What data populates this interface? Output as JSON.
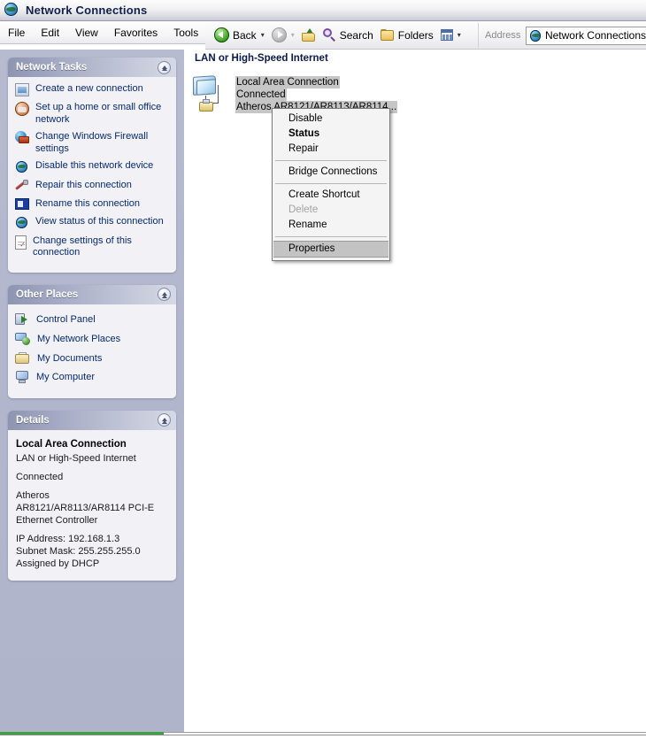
{
  "window": {
    "title": "Network Connections",
    "title_icon": "network-globe-icon"
  },
  "menubar": {
    "items": [
      "File",
      "Edit",
      "View",
      "Favorites",
      "Tools"
    ],
    "overflow": "»"
  },
  "toolbar": {
    "back_label": "Back",
    "back_icon": "back-arrow-icon",
    "forward_icon": "forward-arrow-icon",
    "up_icon": "up-folder-icon",
    "search_label": "Search",
    "search_icon": "magnifier-icon",
    "folders_label": "Folders",
    "folders_icon": "folder-icon",
    "views_icon": "views-icon",
    "caret": "▾"
  },
  "address": {
    "label": "Address",
    "value": "Network Connections",
    "icon": "network-globe-icon"
  },
  "sidebar": {
    "network_tasks": {
      "title": "Network Tasks",
      "toggle_icon": "collapse-chevron-icon",
      "items": [
        {
          "label": "Create a new connection",
          "icon": "new-connection-icon"
        },
        {
          "label": "Set up a home or small office network",
          "icon": "home-network-icon"
        },
        {
          "label": "Change Windows Firewall settings",
          "icon": "firewall-icon"
        },
        {
          "label": "Disable this network device",
          "icon": "network-device-icon"
        },
        {
          "label": "Repair this connection",
          "icon": "repair-wrench-icon"
        },
        {
          "label": "Rename this connection",
          "icon": "rename-icon"
        },
        {
          "label": "View status of this connection",
          "icon": "status-globe-icon"
        },
        {
          "label": "Change settings of this connection",
          "icon": "settings-document-icon"
        }
      ]
    },
    "other_places": {
      "title": "Other Places",
      "toggle_icon": "collapse-chevron-icon",
      "items": [
        {
          "label": "Control Panel",
          "icon": "control-panel-icon"
        },
        {
          "label": "My Network Places",
          "icon": "my-network-places-icon"
        },
        {
          "label": "My Documents",
          "icon": "my-documents-icon"
        },
        {
          "label": "My Computer",
          "icon": "my-computer-icon"
        }
      ]
    },
    "details": {
      "title": "Details",
      "toggle_icon": "collapse-chevron-icon",
      "connection_name": "Local Area Connection",
      "connection_type": "LAN or High-Speed Internet",
      "connection_state": "Connected",
      "adapter_line1": "Atheros",
      "adapter_line2": "AR8121/AR8113/AR8114 PCI-E",
      "adapter_line3": "Ethernet Controller",
      "ip_address": "IP Address: 192.168.1.3",
      "subnet_mask": "Subnet Mask: 255.255.255.0",
      "dhcp": "Assigned by DHCP"
    }
  },
  "content": {
    "group_title": "LAN or High-Speed Internet",
    "connection": {
      "name": "Local Area Connection",
      "status": "Connected",
      "adapter": "Atheros AR8121/AR8113/AR8114...",
      "icon": "lan-connection-icon",
      "selected": true
    }
  },
  "context_menu": {
    "items": [
      {
        "label": "Disable",
        "type": "item"
      },
      {
        "label": "Status",
        "type": "item",
        "bold": true
      },
      {
        "label": "Repair",
        "type": "item"
      },
      {
        "type": "separator"
      },
      {
        "label": "Bridge Connections",
        "type": "item"
      },
      {
        "type": "separator"
      },
      {
        "label": "Create Shortcut",
        "type": "item"
      },
      {
        "label": "Delete",
        "type": "item",
        "disabled": true
      },
      {
        "label": "Rename",
        "type": "item"
      },
      {
        "type": "separator"
      },
      {
        "label": "Properties",
        "type": "item",
        "selected": true
      }
    ]
  },
  "colors": {
    "sidebar_bg": "#b3b7cd",
    "panel_bg": "#f1f1f6",
    "link_text": "#062a6b",
    "selection_gray": "#c6c6c6",
    "menu_selection": "#c3c3c3",
    "accent_green": "#3ea13e"
  }
}
